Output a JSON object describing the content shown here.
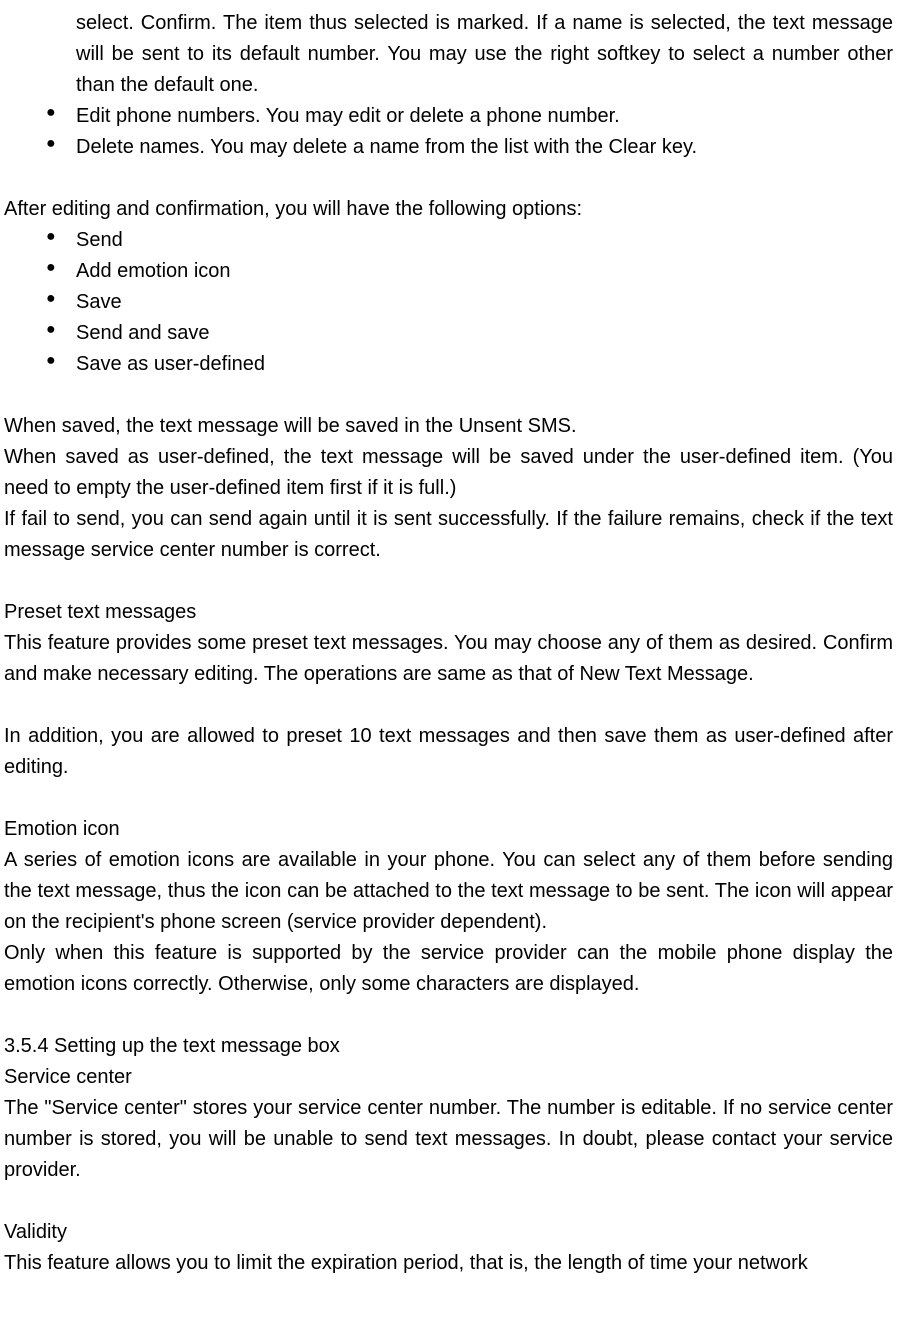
{
  "intro_cont": "select. Confirm. The item thus selected is marked. If a name is selected, the text message will be sent to its default number. You may use the right softkey to select a number other than the default one.",
  "bullets_top": [
    "Edit phone numbers. You may edit or delete a phone number.",
    "Delete names. You may delete a name from the list with the Clear key."
  ],
  "after_editing_intro": "After editing and confirmation, you will have the following options:",
  "bullets_options": [
    "Send",
    "Add emotion icon",
    "Save",
    "Send and save",
    "Save as user-defined"
  ],
  "saved_para1": "When saved, the text message will be saved in the Unsent SMS.",
  "saved_para2": "When saved as user-defined, the text message will be saved under the user-defined item. (You need to empty the user-defined item first if it is full.)",
  "saved_para3": "If fail to send, you can send again until it is sent successfully. If the failure remains, check if the text message service center number is correct.",
  "preset_heading": "Preset text messages",
  "preset_para1": "This feature provides some preset text messages. You may choose any of them as desired. Confirm and make necessary editing. The operations are same as that of New Text Message.",
  "preset_para2": "In addition, you are allowed to preset 10 text messages and then save them as user-defined after editing.",
  "emotion_heading": "Emotion icon",
  "emotion_para1": "A series of emotion icons are available in your phone. You can select any of them before sending the text message, thus the icon can be attached to the text message to be sent. The icon will appear on the recipient's phone screen (service provider dependent).",
  "emotion_para2": "Only when this feature is supported by the service provider can the mobile phone display the emotion icons correctly. Otherwise, only some characters are displayed.",
  "section_354": "3.5.4 Setting up the text message box",
  "service_center_heading": "Service center",
  "service_center_para": "The \"Service center\" stores your service center number. The number is editable. If no service center number is stored, you will be unable to send text messages. In doubt, please contact your service provider.",
  "validity_heading": "Validity",
  "validity_para": "This feature allows you to limit the expiration period, that is, the length of time your network"
}
